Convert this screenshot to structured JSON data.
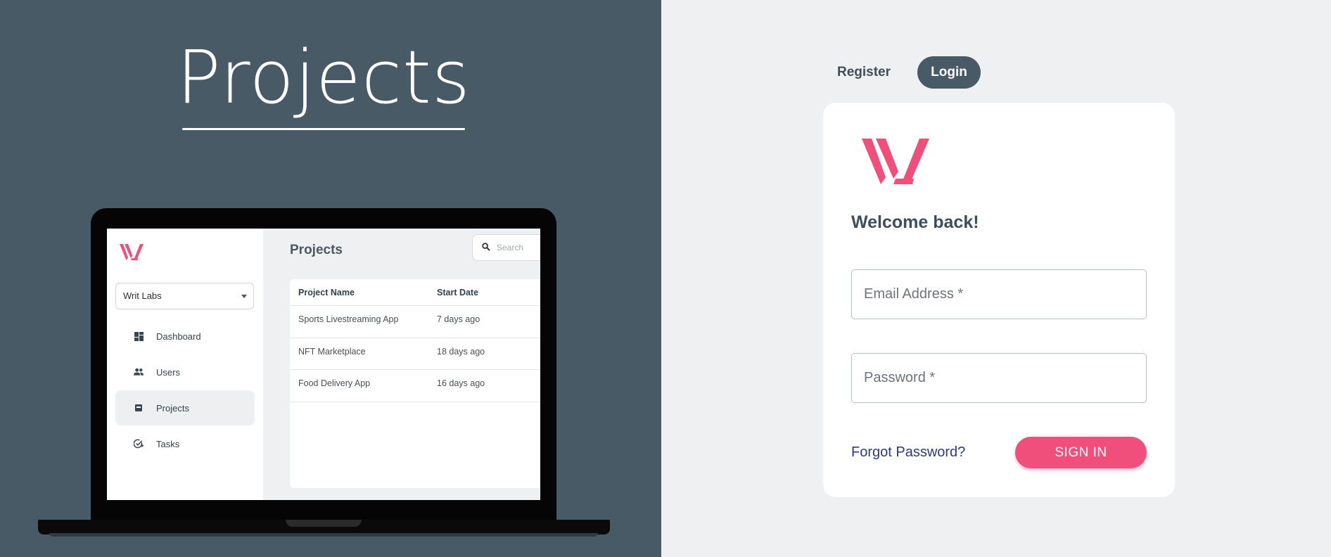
{
  "hero": {
    "title": "Projects"
  },
  "mockup": {
    "org_select": "Writ Labs",
    "nav": [
      {
        "label": "Dashboard",
        "icon": "dashboard-icon"
      },
      {
        "label": "Users",
        "icon": "users-icon"
      },
      {
        "label": "Projects",
        "icon": "projects-icon",
        "active": true
      },
      {
        "label": "Tasks",
        "icon": "tasks-icon"
      }
    ],
    "page_title": "Projects",
    "search_placeholder": "Search",
    "table": {
      "headers": [
        "Project Name",
        "Start Date"
      ],
      "rows": [
        [
          "Sports Livestreaming App",
          "7 days ago"
        ],
        [
          "NFT Marketplace",
          "18 days ago"
        ],
        [
          "Food Delivery App",
          "16 days ago"
        ]
      ]
    }
  },
  "auth_tabs": {
    "register": "Register",
    "login": "Login",
    "active": "login"
  },
  "login_form": {
    "welcome": "Welcome back!",
    "email_placeholder": "Email Address *",
    "password_placeholder": "Password *",
    "forgot_link": "Forgot Password?",
    "submit_label": "SIGN IN"
  },
  "colors": {
    "hero_bg": "#475a65",
    "brand_pink": "#ef4f7a",
    "page_bg": "#eef0f2",
    "card_bg": "#ffffff"
  }
}
